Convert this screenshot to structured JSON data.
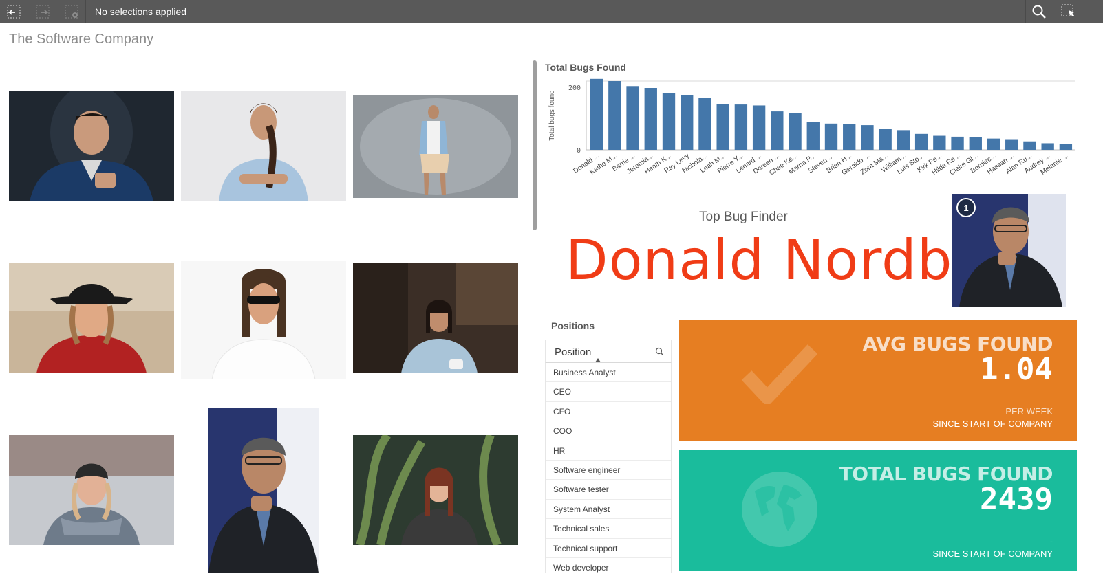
{
  "toolbar": {
    "selection_status": "No selections applied",
    "icons": [
      "selections-back-icon",
      "selections-forward-icon",
      "clear-selections-icon",
      "search-icon",
      "smart-select-icon"
    ]
  },
  "app_title": "The Software Company",
  "chart_data": {
    "type": "bar",
    "title": "Total Bugs Found",
    "xlabel": "",
    "ylabel": "Total bugs found",
    "ytick_labels": [
      "200",
      "0"
    ],
    "ylim": [
      0,
      220
    ],
    "grid": false,
    "color": "#4477aa",
    "categories": [
      "Donald ...",
      "Kathe M...",
      "Barrie ...",
      "Jeremia...",
      "Heath K...",
      "Ray Levy",
      "Nichola...",
      "Leah M...",
      "Pierre Y...",
      "Lenard ...",
      "Doreen ...",
      "Chae Ke...",
      "Marna P...",
      "Steven ...",
      "Brian H...",
      "Geraldo ...",
      "Zora Ma...",
      "William...",
      "Luis Sto...",
      "Kirk Pe...",
      "Hilda Re...",
      "Claire Gl...",
      "Berniec...",
      "Hassan ...",
      "Alan Ru...",
      "Audrey ...",
      "Melanie ..."
    ],
    "values": [
      227,
      220,
      204,
      198,
      181,
      176,
      167,
      146,
      145,
      142,
      123,
      117,
      89,
      84,
      82,
      79,
      66,
      63,
      51,
      45,
      42,
      40,
      36,
      34,
      27,
      21,
      18
    ]
  },
  "top_bug_finder": {
    "label": "Top Bug Finder",
    "name": "Donald Nordby",
    "rank": "1"
  },
  "positions": {
    "title": "Positions",
    "header": "Position",
    "items": [
      "Business Analyst",
      "CEO",
      "CFO",
      "COO",
      "HR",
      "Software engineer",
      "Software tester",
      "System Analyst",
      "Technical sales",
      "Technical support",
      "Web developer"
    ]
  },
  "kpi_avg": {
    "title": "AVG BUGS FOUND",
    "value": "1.04",
    "sub1": "PER WEEK",
    "sub2": "SINCE START OF COMPANY",
    "color": "#e67e22",
    "icon": "checkmark-icon"
  },
  "kpi_total": {
    "title": "TOTAL BUGS FOUND",
    "value": "2439",
    "sub1": "-",
    "sub2": "SINCE START OF COMPANY",
    "color": "#1abc9c",
    "icon": "globe-icon"
  },
  "colors": {
    "toolbar": "#595959",
    "highlight_name": "#f03c16",
    "bar": "#4477aa"
  }
}
